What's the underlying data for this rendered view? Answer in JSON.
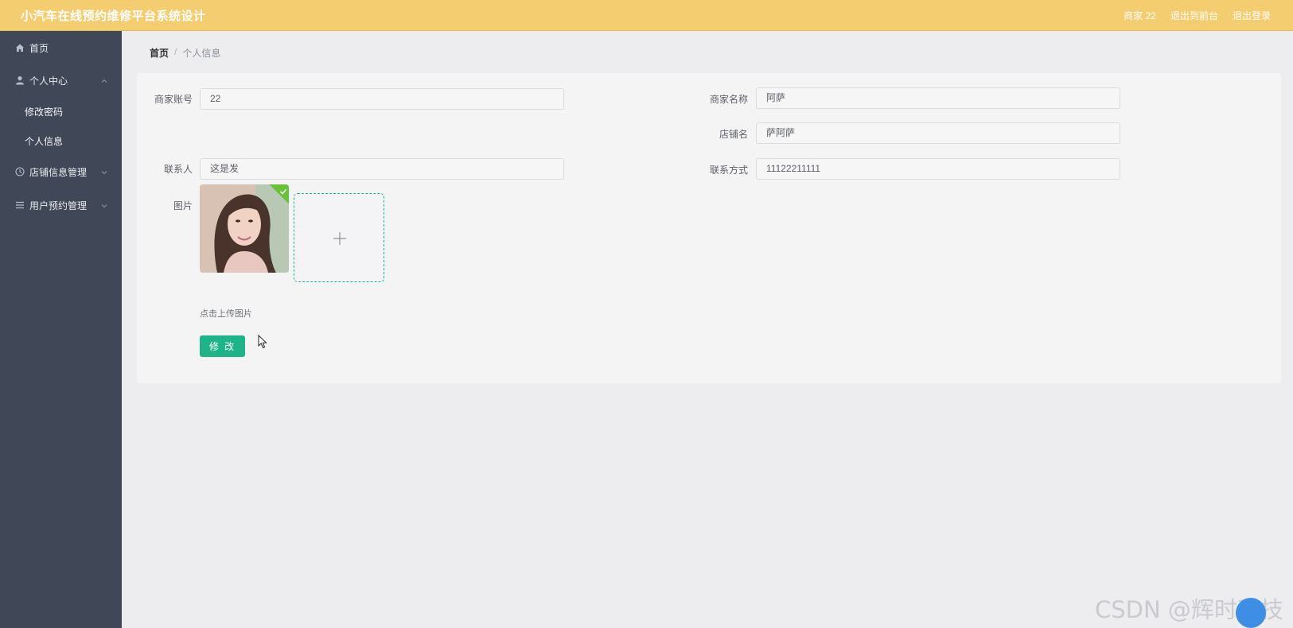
{
  "header": {
    "title": "小汽车在线预约维修平台系统设计",
    "user": "商家 22",
    "front_link": "退出到前台",
    "logout": "退出登录"
  },
  "sidebar": {
    "home": "首页",
    "personal_center": "个人中心",
    "change_password": "修改密码",
    "personal_info": "个人信息",
    "shop_info_mgmt": "店铺信息管理",
    "booking_mgmt": "用户预约管理"
  },
  "breadcrumb": {
    "home": "首页",
    "separator": "/",
    "current": "个人信息"
  },
  "form": {
    "account_label": "商家账号",
    "account_value": "22",
    "merchant_name_label": "商家名称",
    "merchant_name_value": "阿萨",
    "shop_name_label": "店铺名",
    "shop_name_value": "萨阿萨",
    "contact_label": "联系人",
    "contact_value": "这是发",
    "phone_label": "联系方式",
    "phone_value": "11122211111",
    "image_label": "图片",
    "upload_hint": "点击上传图片",
    "submit": "修 改"
  },
  "watermark": "CSDN @辉时科技",
  "colors": {
    "header_bg": "#f4cd70",
    "sidebar_bg": "#404757",
    "primary_button": "#1fb389",
    "upload_border": "#1ab394"
  }
}
